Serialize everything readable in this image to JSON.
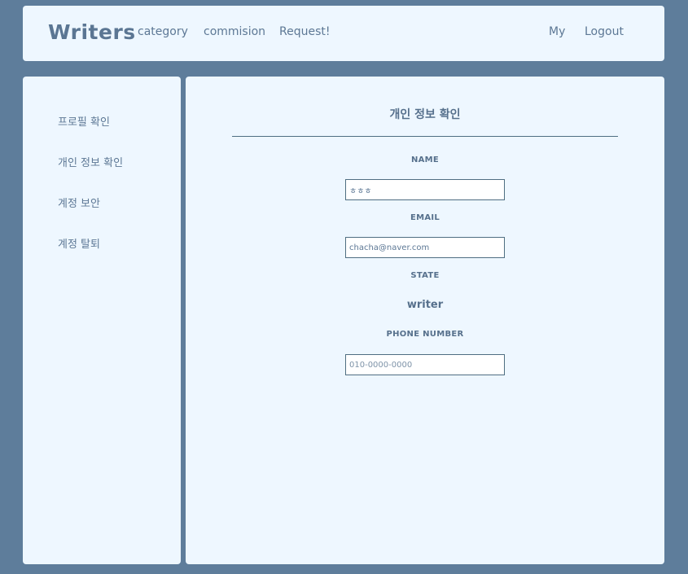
{
  "header": {
    "brand": "Writers",
    "nav": {
      "category": "category",
      "commision": "commision",
      "request": "Request!",
      "my": "My",
      "logout": "Logout"
    }
  },
  "sidebar": {
    "items": [
      {
        "label": "프로필 확인"
      },
      {
        "label": "개인 정보 확인"
      },
      {
        "label": "계정 보안"
      },
      {
        "label": "계정 탈퇴"
      }
    ]
  },
  "main": {
    "title": "개인 정보 확인",
    "fields": {
      "name": {
        "label": "NAME",
        "value": "ㅎㅎㅎ"
      },
      "email": {
        "label": "EMAIL",
        "value": "chacha@naver.com"
      },
      "state": {
        "label": "STATE",
        "value": "writer"
      },
      "phone": {
        "label": "PHONE NUMBER",
        "placeholder": "010-0000-0000"
      }
    }
  },
  "colors": {
    "background": "#5e7d9b",
    "card": "#eef7ff",
    "text": "#5d7895",
    "border": "#4f6e82"
  }
}
